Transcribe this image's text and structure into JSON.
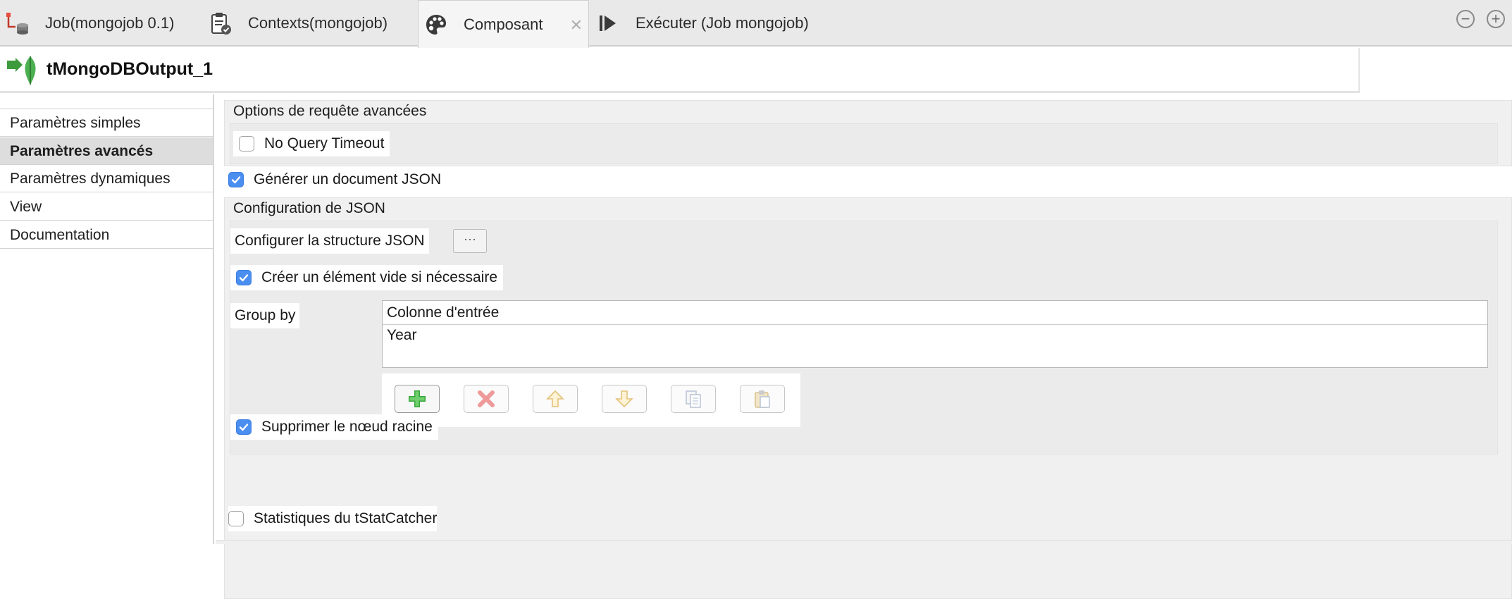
{
  "tabs": [
    {
      "label": "Job(mongojob 0.1)",
      "icon": "job-icon"
    },
    {
      "label": "Contexts(mongojob)",
      "icon": "clipboard-check-icon"
    },
    {
      "label": "Composant",
      "icon": "palette-icon",
      "active": true
    },
    {
      "label": "Exécuter (Job mongojob)",
      "icon": "run-icon"
    }
  ],
  "component": {
    "name": "tMongoDBOutput_1",
    "icon": "mongodb-leaf-icon"
  },
  "nav": {
    "items": [
      {
        "label": "Paramètres simples"
      },
      {
        "label": "Paramètres avancés",
        "active": true
      },
      {
        "label": "Paramètres dynamiques"
      },
      {
        "label": "View"
      },
      {
        "label": "Documentation"
      }
    ]
  },
  "advanced_query": {
    "title": "Options de requête avancées",
    "no_query_timeout": {
      "label": "No Query Timeout",
      "checked": false
    }
  },
  "generate_json": {
    "label": "Générer un document JSON",
    "checked": true
  },
  "json_config": {
    "title": "Configuration de JSON",
    "configure_label": "Configurer la structure JSON",
    "configure_button": "···",
    "create_empty": {
      "label": "Créer un élément vide si nécessaire",
      "checked": true
    },
    "group_by": {
      "label": "Group by",
      "column_header": "Colonne d'entrée",
      "rows": [
        "Year"
      ]
    },
    "remove_root": {
      "label": "Supprimer le nœud racine",
      "checked": true
    }
  },
  "stat_catcher": {
    "label": "Statistiques du tStatCatcher",
    "checked": false
  },
  "colors": {
    "accent": "#4a8ef0",
    "add": "#3aa53a",
    "remove": "#e06666"
  }
}
